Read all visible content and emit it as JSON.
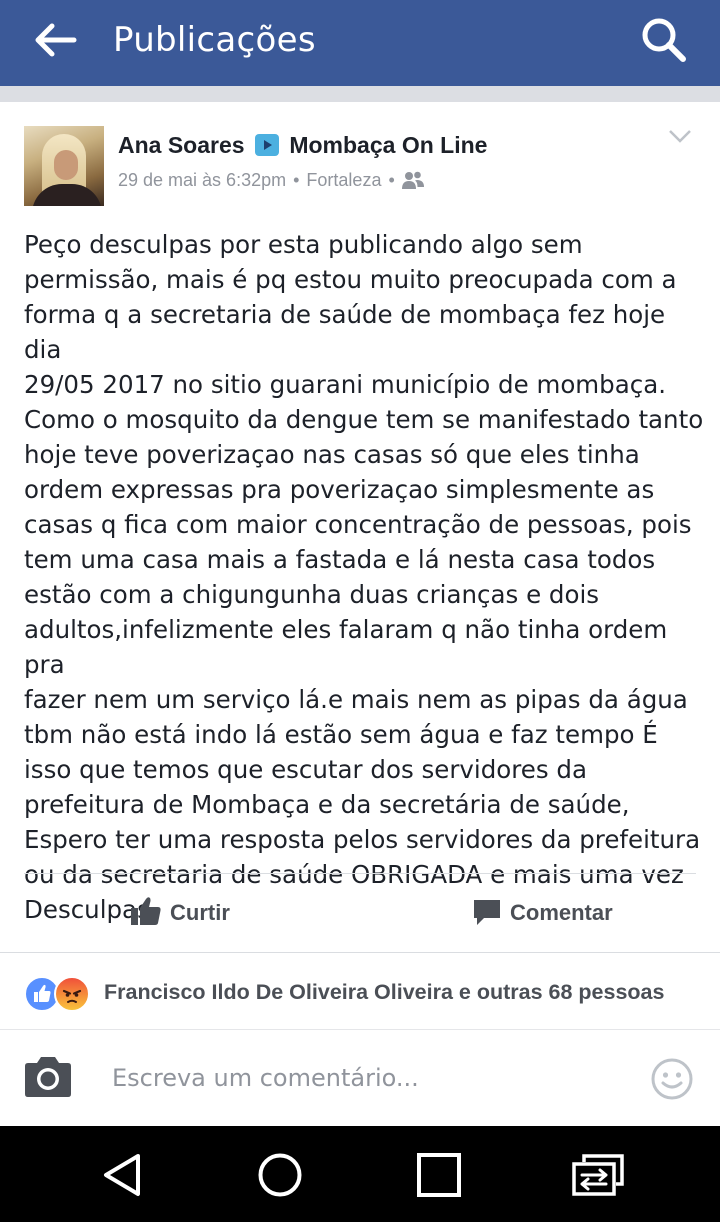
{
  "topbar": {
    "title": "Publicações",
    "back_icon": "arrow-left-icon",
    "search_icon": "search-icon",
    "color": "#3b5998"
  },
  "post": {
    "author": "Ana Soares",
    "target_page": "Mombaça On Line",
    "timestamp": "29 de mai às 6:32pm",
    "location": "Fortaleza",
    "separator": "•",
    "audience_icon": "friends-icon",
    "text": "Peço desculpas por esta publicando algo sem\npermissão, mais é pq estou muito preocupada com a\nforma q a secretaria de saúde de mombaça fez hoje dia\n29/05 2017 no sitio guarani município de mombaça.\nComo o mosquito da dengue tem se manifestado tanto\nhoje teve poverizaçao nas casas só que eles tinha\nordem expressas pra poverizaçao simplesmente as\ncasas q fica com maior concentração de pessoas, pois\ntem uma casa mais a fastada e lá nesta casa todos\nestão com a chigungunha duas crianças e dois\nadultos,infelizmente eles falaram q não tinha ordem pra\nfazer nem um serviço lá.e mais nem as pipas da água\ntbm não está indo lá estão sem água e faz tempo É\nisso que temos que escutar dos servidores da\nprefeitura de Mombaça e da secretária de saúde,\nEspero ter uma resposta pelos servidores da prefeitura\nou da secretaria de saúde OBRIGADA e mais uma vez\nDesculpas."
  },
  "actions": {
    "like_label": "Curtir",
    "comment_label": "Comentar"
  },
  "reactions": {
    "summary": "Francisco Ildo De Oliveira Oliveira e outras 68 pessoas",
    "icons": [
      "like-reaction-icon",
      "angry-reaction-icon"
    ]
  },
  "composer": {
    "placeholder": "Escreva um comentário..."
  },
  "system_nav": {
    "buttons": [
      "back-triangle-icon",
      "home-circle-icon",
      "recents-square-icon",
      "switch-apps-icon"
    ]
  }
}
